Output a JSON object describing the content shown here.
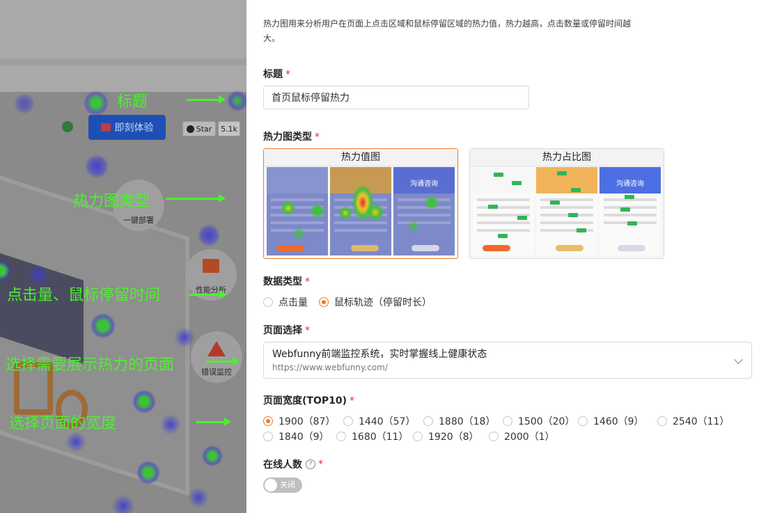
{
  "background": {
    "mock_button": "即刻体验",
    "github_star": "Star",
    "github_count": "5.1k",
    "features": [
      "一键部署",
      "性能分析",
      "错误监控"
    ],
    "annotations": [
      "标题",
      "热力图类型",
      "点击量、鼠标停留时间",
      "选择需要展示热力的页面",
      "选择页面的宽度"
    ]
  },
  "panel": {
    "description": "热力图用来分析用户在页面上点击区域和鼠标停留区域的热力值，热力越高，点击数量或停留时间越大。",
    "title_field": {
      "label": "标题",
      "value": "首页鼠标停留热力"
    },
    "heatmap_type": {
      "label": "热力图类型",
      "options": [
        "热力值图",
        "热力占比图"
      ],
      "selected": "热力值图",
      "thumb_text": "沟通咨询"
    },
    "data_type": {
      "label": "数据类型",
      "options": [
        "点击量",
        "鼠标轨迹（停留时长）"
      ],
      "selected": "鼠标轨迹（停留时长）"
    },
    "page_select": {
      "label": "页面选择",
      "title": "Webfunny前端监控系统，实时掌握线上健康状态",
      "url": "https://www.webfunny.com/"
    },
    "page_width": {
      "label": "页面宽度(TOP10)",
      "row1": [
        "1900（87）",
        "1440（57）",
        "1880（18）",
        "1500（20）",
        "1460（9）",
        "2540（11）"
      ],
      "row2": [
        "1840（9）",
        "1680（11）",
        "1920（8）",
        "2000（1）"
      ],
      "selected": "1900（87）"
    },
    "online_users": {
      "label": "在线人数",
      "help": "?",
      "switch_text": "关闭"
    }
  },
  "colors": {
    "accent": "#f07a2b",
    "required": "#f5222d",
    "annotation": "#4df02f"
  }
}
